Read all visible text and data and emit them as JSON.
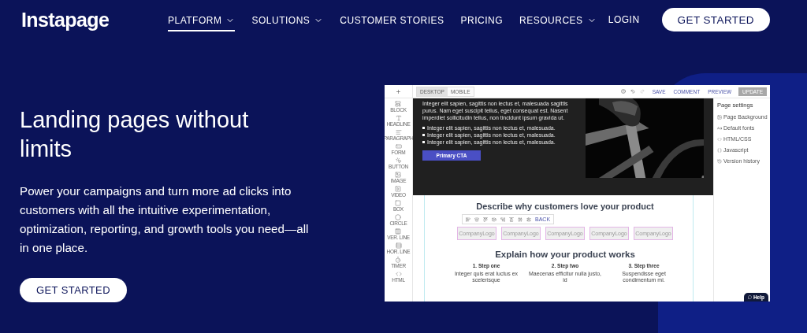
{
  "nav": {
    "logo": "Instapage",
    "items": [
      {
        "label": "PLATFORM",
        "dropdown": true,
        "selected": true
      },
      {
        "label": "SOLUTIONS",
        "dropdown": true,
        "selected": false
      },
      {
        "label": "CUSTOMER STORIES",
        "dropdown": false,
        "selected": false
      },
      {
        "label": "PRICING",
        "dropdown": false,
        "selected": false
      },
      {
        "label": "RESOURCES",
        "dropdown": true,
        "selected": false
      }
    ],
    "login": "LOGIN",
    "cta": "GET STARTED"
  },
  "hero": {
    "title": "Landing pages without limits",
    "body": "Power your campaigns and turn more ad clicks into customers with all the intuitive experimentation, optimization, reporting, and growth tools you need—all in one place.",
    "cta": "GET STARTED"
  },
  "editor": {
    "device_tabs": [
      {
        "label": "DESKTOP",
        "selected": true
      },
      {
        "label": "MOBILE",
        "selected": false
      }
    ],
    "actions": [
      "SAVE",
      "COMMENT",
      "PREVIEW"
    ],
    "update": "UPDATE",
    "tools": [
      "BLOCK",
      "HEADLINE",
      "PARAGRAPH",
      "FORM",
      "BUTTON",
      "IMAGE",
      "VIDEO",
      "BOX",
      "CIRCLE",
      "VER. LINE",
      "HOR. LINE",
      "TIMER",
      "HTML"
    ],
    "hero_text": "Integer elit sapien, sagittis non lectus et, malesuada sagittis purus. Nam eget suscipit tellus, eget consequat est. Nasent imperdiet sollicitudin tellus, non tincidunt ipsum gravida ut.",
    "bullets": [
      "Integer elit sapien, sagittis non lectus et, malesuada.",
      "Integer elit sapien, sagittis non lectus et, malesuada.",
      "Integer elit sapien, sagittis non lectus et, malesuada."
    ],
    "primary_cta": "Primary CTA",
    "logos_heading": "Describe why customers love your product",
    "logos": [
      "CompanyLogo",
      "CompanyLogo",
      "CompanyLogo",
      "CompanyLogo",
      "CompanyLogo"
    ],
    "back": "BACK",
    "steps_heading": "Explain how your product works",
    "steps": [
      {
        "title": "1. Step one",
        "text": "Integer quis erat luctus ex scelerisque"
      },
      {
        "title": "2. Step two",
        "text": "Maecenas efficitur nulla justo, id"
      },
      {
        "title": "3. Step three",
        "text": "Suspendisse eget condimentum mi."
      }
    ],
    "panel_title": "Page settings",
    "panel_items": [
      "Page Background",
      "Default fonts",
      "HTML/CSS",
      "Javascript",
      "Version history"
    ],
    "help": "Help"
  }
}
